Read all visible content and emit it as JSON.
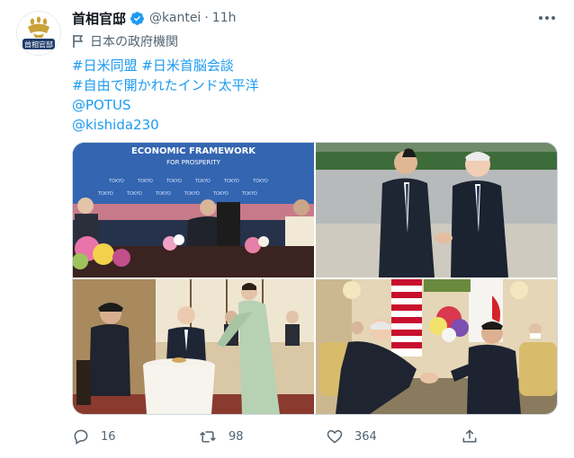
{
  "tweet": {
    "display_name": "首相官邸",
    "handle": "@kantei",
    "separator": "·",
    "time": "11h",
    "affiliation": "日本の政府機関",
    "lines": [
      "#日米同盟 #日米首脳会談",
      "#自由で開かれたインド太平洋",
      "@POTUS",
      "@kishida230"
    ],
    "avatar_text": "首相官邸",
    "accent_color": "#1d9bf0",
    "icons": [
      "verified-badge-icon",
      "more-icon",
      "flag-icon",
      "reply-icon",
      "retweet-icon",
      "like-icon",
      "share-icon"
    ]
  },
  "media": {
    "banner_line1": "ECONOMIC FRAMEWORK",
    "banner_line2": "FOR PROSPERITY",
    "banner_word": "TOKYO"
  },
  "actions": {
    "replies": "16",
    "retweets": "98",
    "likes": "364"
  }
}
